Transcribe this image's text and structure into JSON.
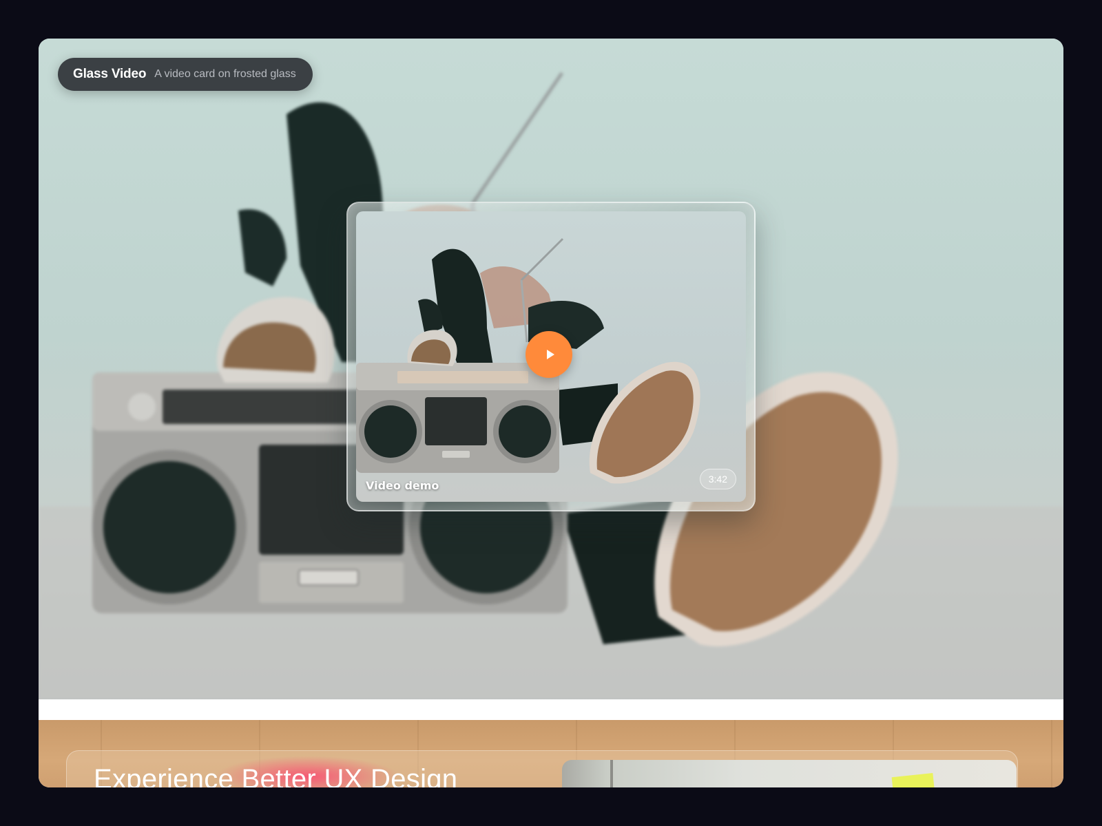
{
  "header": {
    "title": "Glass Video",
    "subtitle": "A video card on frosted glass"
  },
  "video_card": {
    "title": "Video demo",
    "duration": "3:42",
    "play_icon": "play-icon"
  },
  "next_section": {
    "headline": "Experience Better UX Design"
  },
  "colors": {
    "page_background": "#0b0b16",
    "play_button": "#ff8a3a",
    "pill_background": "#282a30",
    "headline_glow": "#ff3c6e"
  }
}
